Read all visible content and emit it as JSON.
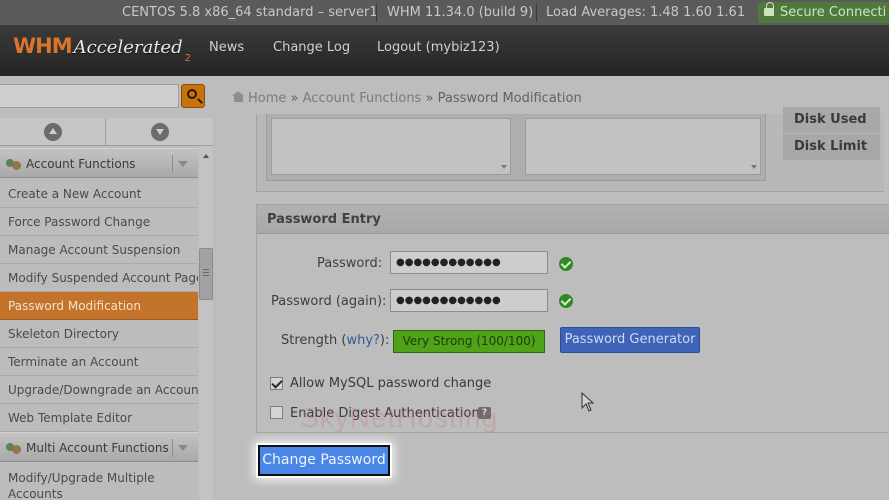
{
  "statusbar": {
    "system": "CENTOS 5.8 x86_64 standard – server1",
    "version": "WHM 11.34.0 (build 9)",
    "load": "Load Averages: 1.48 1.60 1.61",
    "secure": "Secure Connecti"
  },
  "header": {
    "logo_whm": "WHM",
    "logo_accelerated": "Accelerated",
    "logo_two": "2",
    "nav": [
      "News",
      "Change Log",
      "Logout (mybiz123)"
    ]
  },
  "search": {
    "placeholder": ""
  },
  "sidebar": {
    "category1": "Account Functions",
    "items": [
      "Create a New Account",
      "Force Password Change",
      "Manage Account Suspension",
      "Modify Suspended Account Page",
      "Password Modification",
      "Skeleton Directory",
      "Terminate an Account",
      "Upgrade/Downgrade an Account",
      "Web Template Editor"
    ],
    "active_item": "Password Modification",
    "category2": "Multi Account Functions",
    "items2": [
      "Modify/Upgrade Multiple",
      "Accounts"
    ]
  },
  "breadcrumb": {
    "home": "Home",
    "sep": "»",
    "level1": "Account Functions",
    "level2": "Password Modification"
  },
  "sort_buttons": {
    "disk_used": "Disk Used",
    "disk_limit": "Disk Limit"
  },
  "password_entry": {
    "title": "Password Entry",
    "password_label": "Password:",
    "password_value": "●●●●●●●●●●●●",
    "password_again_label": "Password (again):",
    "password_again_value": "●●●●●●●●●●●●",
    "strength_label": "Strength (",
    "why_link": "why?",
    "strength_label_end": "):",
    "strength_value": "Very Strong (100/100)",
    "generator_button": "Password Generator",
    "mysql_checkbox_label": "Allow MySQL password change",
    "mysql_checked": true,
    "digest_checkbox_label": "Enable Digest Authentication",
    "digest_checked": false,
    "help_icon_text": "?"
  },
  "watermark": "SkyNetHosting",
  "submit_button": "Change Password",
  "colors": {
    "accent_orange": "#c4742a",
    "strength_green": "#4fa21a",
    "button_blue": "#4a86e6",
    "generator_blue": "#3f63b7"
  }
}
